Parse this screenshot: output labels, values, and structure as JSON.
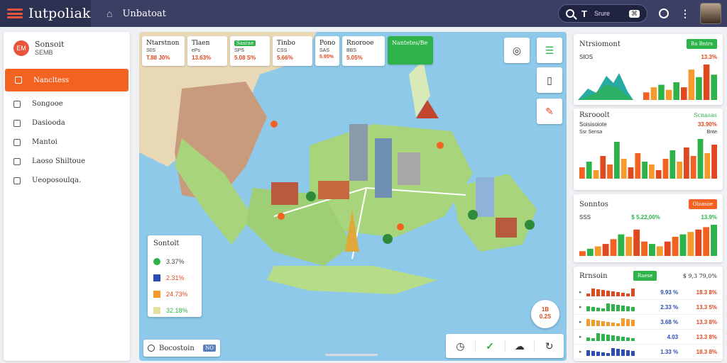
{
  "header": {
    "app_title": "Iutpoliak",
    "breadcrumb": "Unbatoat",
    "search_letter": "T",
    "search_text": "Srure",
    "search_kbd": "⌘"
  },
  "sidebar": {
    "brand_title": "Sonsoit",
    "brand_sub": "SEMB",
    "brand_badge": "EM",
    "items": [
      {
        "label": "Nancltess",
        "active": true
      },
      {
        "label": "Songooe"
      },
      {
        "label": "Dasiooda"
      },
      {
        "label": "Mantoi"
      },
      {
        "label": "Laoso Shiltoue"
      },
      {
        "label": "Ueoposoulqa."
      }
    ]
  },
  "map": {
    "stat_cards": [
      {
        "label": "Ntarstnon",
        "sub": "S0S",
        "value": "T.88 J0%"
      },
      {
        "label": "Tlaen",
        "sub": "ePs",
        "value": "13.63%"
      },
      {
        "label": "Sasrae",
        "sub": "SPS",
        "value": "5.08 S%",
        "tag": true
      },
      {
        "label": "Tinbo",
        "sub": "CSS",
        "value": "5.66%"
      },
      {
        "label": "Pono",
        "sub": "SAS",
        "value": "5.95%"
      },
      {
        "label": "Rnorooe",
        "sub": "BBS",
        "value": "5.05%"
      },
      {
        "label": "Nantetes/Be",
        "green": true
      }
    ],
    "legend": {
      "title": "Sontolt",
      "rows": [
        {
          "color": "#2db34a",
          "shape": "circle",
          "value": "3.37%",
          "vcolor": "#444"
        },
        {
          "color": "#2a4cb3",
          "value": "2.31%",
          "vcolor": "#e0481f"
        },
        {
          "color": "#f59a2c",
          "value": "24.73%",
          "vcolor": "#e0481f"
        },
        {
          "color": "#e5e0a0",
          "value": "32.18%",
          "vcolor": "#2db34a"
        }
      ]
    },
    "search_placeholder": "Bocostoin",
    "search_chip": "NO",
    "zoom_badge_1": "1B",
    "zoom_badge_2": "0.2S"
  },
  "panels": {
    "p1": {
      "title": "Ntrsiomont",
      "button": "Ba Bntrs",
      "meta_left": "SIOS",
      "meta_right": "13.3%"
    },
    "p2": {
      "title": "Rsrooolt",
      "right_label": "Scnasas",
      "row_label": "Soisisoiote",
      "row_value": "33.90%",
      "sub_label": "Ssr Sensa",
      "sub_value": "Bnte"
    },
    "p3": {
      "title": "Sonntos",
      "button": "Oloasoe",
      "meta_left": "SSS",
      "meta_mid": "$ 5.22,00%",
      "meta_right": "13.9%"
    },
    "p4": {
      "title": "Rrnsoin",
      "button": "Raese",
      "right_label": "$ 9,3 79,0%",
      "rows": [
        {
          "v1": "9.93 %",
          "v2": "18.3 8%"
        },
        {
          "v1": "2.33 %",
          "v2": "13.3 5%"
        },
        {
          "v1": "3.68 %",
          "v2": "13.3 8%"
        },
        {
          "v1": "4.03",
          "v2": "13.3 8%"
        },
        {
          "v1": "1.33 %",
          "v2": "18.3 8%"
        }
      ]
    }
  },
  "chart_data": [
    {
      "type": "bar",
      "values": [
        3,
        5,
        6,
        4,
        7,
        5,
        12,
        9,
        14,
        10
      ],
      "colors": [
        "#f26322",
        "#f59a2c",
        "#2db34a",
        "#f59a2c",
        "#2db34a",
        "#e0481f",
        "#f59a2c",
        "#2db34a",
        "#e0481f",
        "#2db34a"
      ]
    },
    {
      "type": "bar",
      "values": [
        4,
        6,
        3,
        8,
        5,
        13,
        7,
        4,
        9,
        6,
        5,
        3,
        7,
        10,
        6,
        11,
        8,
        14,
        9,
        12
      ]
    },
    {
      "type": "bar",
      "values": [
        2,
        3,
        4,
        5,
        7,
        9,
        8,
        11,
        6,
        5,
        4,
        6,
        8,
        9,
        10,
        11,
        12,
        13
      ]
    }
  ]
}
